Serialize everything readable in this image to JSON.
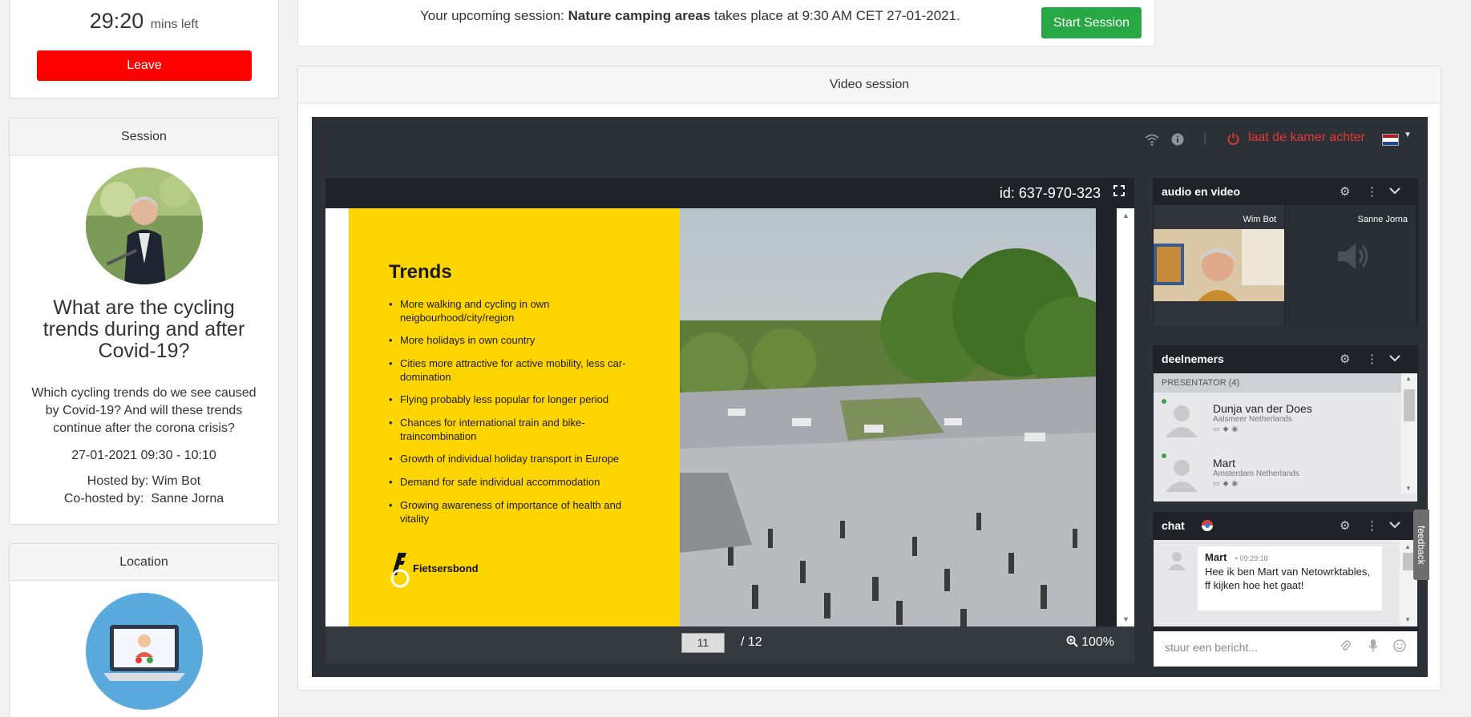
{
  "timer": {
    "value": "29:20",
    "unit": "mins left",
    "leave_label": "Leave"
  },
  "session": {
    "header": "Session",
    "title": "What are the cycling trends during and after Covid-19?",
    "description": "Which cycling trends do we see caused by Covid-19? And will these trends continue after the corona crisis?",
    "datetime": "27-01-2021 09:30 - 10:10",
    "hosted_label": "Hosted by:",
    "host": "Wim Bot",
    "cohosted_label": "Co-hosted by:",
    "cohost": "Sanne Jorna"
  },
  "location": {
    "header": "Location"
  },
  "banner": {
    "prefix": "Your upcoming session:",
    "session_name": "Nature camping areas",
    "suffix": "takes place at 9:30 AM CET 27-01-2021.",
    "start_label": "Start Session"
  },
  "video": {
    "header": "Video session",
    "leave_room": "laat de kamer achter",
    "presentation_id": "id: 637-970-323",
    "current_page": "11",
    "total_pages": "/ 12",
    "zoom": "100%"
  },
  "slide": {
    "title": "Trends",
    "bullets": [
      "More walking and cycling in own neigbourhood/city/region",
      "More holidays in own country",
      "Cities more attractive for active mobility, less car-domination",
      "Flying probably less popular for longer period",
      "Chances for international train and bike-traincombination",
      "Growth of individual holiday transport in Europe",
      "Demand for safe individual accommodation",
      "Growing awareness of importance of health and vitality"
    ],
    "brand": "Fietsersbond"
  },
  "av": {
    "title": "audio en video",
    "participants": [
      "Wim Bot",
      "Sanne Jorna"
    ]
  },
  "participants": {
    "title": "deelnemers",
    "group_label": "PRESENTATOR",
    "group_count": "(4)",
    "list": [
      {
        "name": "Dunja van der Does",
        "location": "Aalsmeer Netherlands"
      },
      {
        "name": "Mart",
        "location": "Amsterdam Netherlands"
      }
    ]
  },
  "chat": {
    "title": "chat",
    "messages": [
      {
        "author": "Mart",
        "time": "• 09:29:18",
        "text": "Hee ik ben Mart van Netowrktables, ff kijken hoe het gaat!"
      }
    ],
    "input_placeholder": "stuur een bericht..."
  },
  "feedback_label": "feedback",
  "colors": {
    "leave_red": "#ff0000",
    "start_green": "#28a745",
    "slide_yellow": "#ffd500",
    "room_dark": "#2c3138"
  },
  "icons": [
    "wifi-icon",
    "info-icon",
    "power-icon",
    "flag-nl-icon",
    "expand-icon",
    "zoom-icon",
    "gear-icon",
    "more-icon",
    "chevron-down-icon",
    "attach-icon",
    "mic-icon",
    "emoji-icon",
    "speaker-icon"
  ]
}
